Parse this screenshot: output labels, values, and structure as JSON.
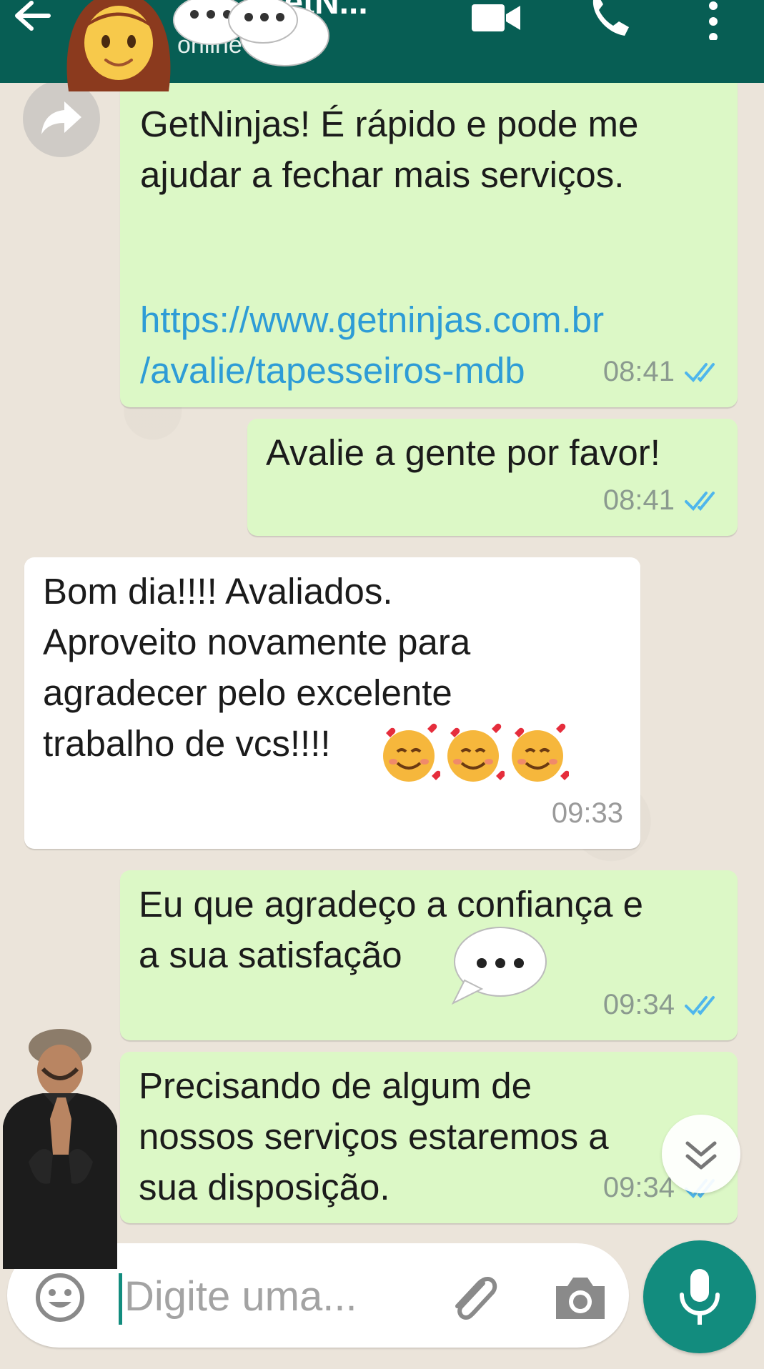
{
  "header": {
    "title": "GetN...",
    "status": "online"
  },
  "messages": [
    {
      "direction": "outgoing",
      "text": "GetNinjas! É rápido e pode me\najudar a fechar mais serviços.",
      "link": "https://www.getninjas.com.br\n/avalie/tapesseiros-mdb",
      "time": "08:41",
      "read": true
    },
    {
      "direction": "outgoing",
      "text": "Avalie a gente por favor!",
      "time": "08:41",
      "read": true
    },
    {
      "direction": "incoming",
      "text": "Bom dia!!!! Avaliados.\nAproveito novamente para\nagradecer pelo excelente\ntrabalho de vcs!!!!",
      "emoji": [
        "smiling-face-with-hearts",
        "smiling-face-with-hearts",
        "smiling-face-with-hearts"
      ],
      "time": "09:33"
    },
    {
      "direction": "outgoing",
      "text_line1": "Eu que agradeço a confiança e",
      "text_line2_start": "a sua satisfação ",
      "text_line2_end": "!!!",
      "time": "09:34",
      "read": true
    },
    {
      "direction": "outgoing",
      "text": "Precisando de algum de\nnossos serviços estaremos a\nsua disposição.",
      "time": "09:34",
      "read": true
    }
  ],
  "composer": {
    "placeholder": "Digite uma..."
  },
  "icons": {
    "back": "arrow-left-icon",
    "video": "video-camera-icon",
    "call": "phone-icon",
    "menu": "more-vertical-icon",
    "forward": "forward-icon",
    "emoji": "smiley-icon",
    "attach": "paperclip-icon",
    "camera": "camera-icon",
    "mic": "microphone-icon",
    "scroll": "double-chevron-down-icon"
  },
  "colors": {
    "header": "#075e54",
    "outgoing_bubble": "#dcf8c6",
    "incoming_bubble": "#ffffff",
    "link": "#2e9cd6",
    "accent": "#128c7e",
    "read_ticks": "#4fb6ec"
  }
}
